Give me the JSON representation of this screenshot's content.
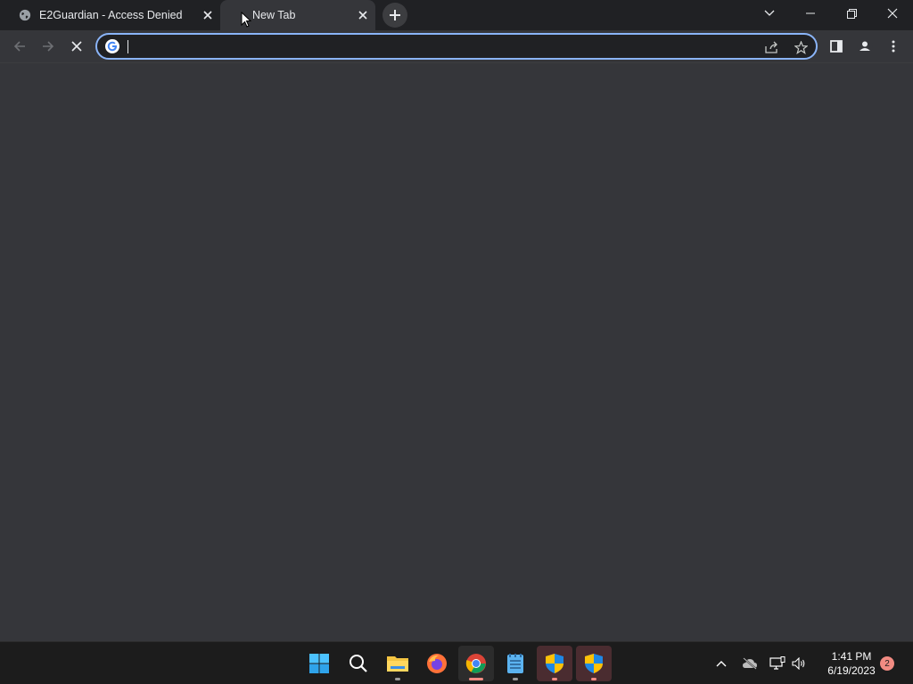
{
  "browser": {
    "tabs": [
      {
        "title": "E2Guardian - Access Denied",
        "favicon": "globe-icon",
        "active": false
      },
      {
        "title": "New Tab",
        "favicon": "loading-spinner-icon",
        "active": true
      }
    ],
    "omnibox": {
      "value": "",
      "placeholder": ""
    }
  },
  "taskbar": {
    "apps": [
      {
        "name": "Start",
        "icon": "windows-start-icon"
      },
      {
        "name": "Search",
        "icon": "search-icon"
      },
      {
        "name": "File Explorer",
        "icon": "folder-icon"
      },
      {
        "name": "Firefox",
        "icon": "firefox-icon"
      },
      {
        "name": "Chrome",
        "icon": "chrome-icon"
      },
      {
        "name": "Notepad",
        "icon": "notepad-icon"
      },
      {
        "name": "Security",
        "icon": "shield-icon"
      },
      {
        "name": "Security",
        "icon": "shield-icon"
      }
    ],
    "clock": {
      "time": "1:41 PM",
      "date": "6/19/2023"
    },
    "notification_count": "2"
  },
  "colors": {
    "titlebar": "#202124",
    "toolbar": "#35363a",
    "focus_ring": "#8ab4f8",
    "taskbar": "#1c1c1c"
  }
}
